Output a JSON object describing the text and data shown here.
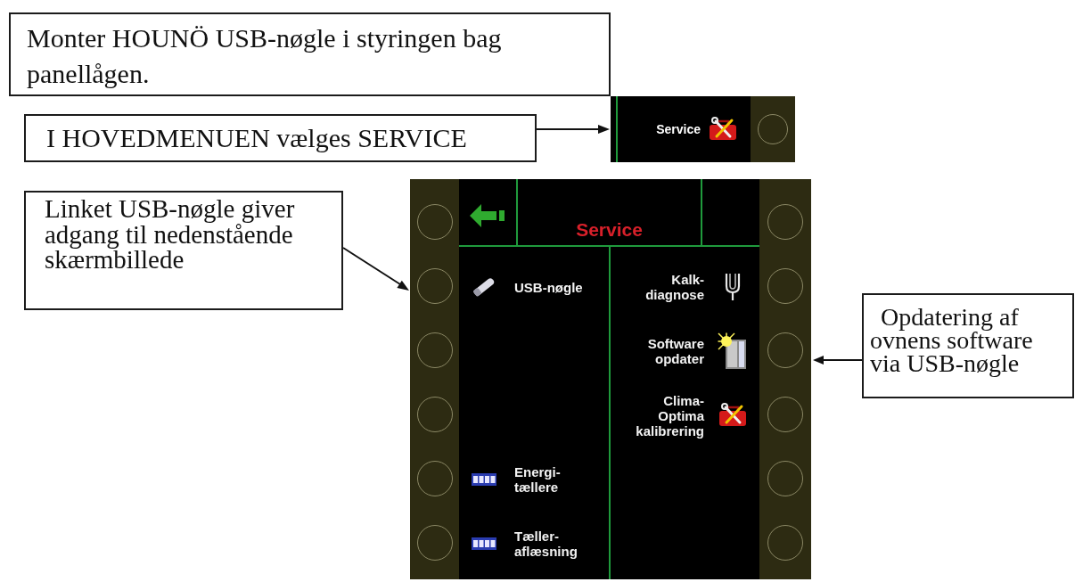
{
  "callouts": [
    {
      "text": "Monter HOUNÖ USB-nøgle i styringen bag panellågen."
    },
    {
      "text": "I HOVEDMENUEN vælges SERVICE"
    },
    {
      "text": "Linket USB-nøgle giver adgang til nedenstående skærmbillede"
    },
    {
      "text": "Opdatering af ovnens software via USB-nøgle"
    }
  ],
  "main_menu_entry": {
    "label": "Service",
    "kind": "toolbox"
  },
  "service_screen": {
    "title": "Service",
    "menu_rows": [
      {
        "left": {
          "label": "USB-nøgle",
          "kind": "usb"
        },
        "right": {
          "label": "Kalk-\ndiagnose",
          "kind": "fork"
        }
      },
      {
        "right": {
          "label": "Software\nopdater",
          "kind": "cabinet"
        }
      },
      {
        "right": {
          "label": "Clima-\nOptima\nkalibrering",
          "kind": "toolbox"
        }
      },
      {
        "left": {
          "label": "Energi-\ntællere",
          "kind": "counter"
        }
      },
      {
        "left": {
          "label": "Tæller-\naflæsning",
          "kind": "counter"
        }
      }
    ]
  }
}
